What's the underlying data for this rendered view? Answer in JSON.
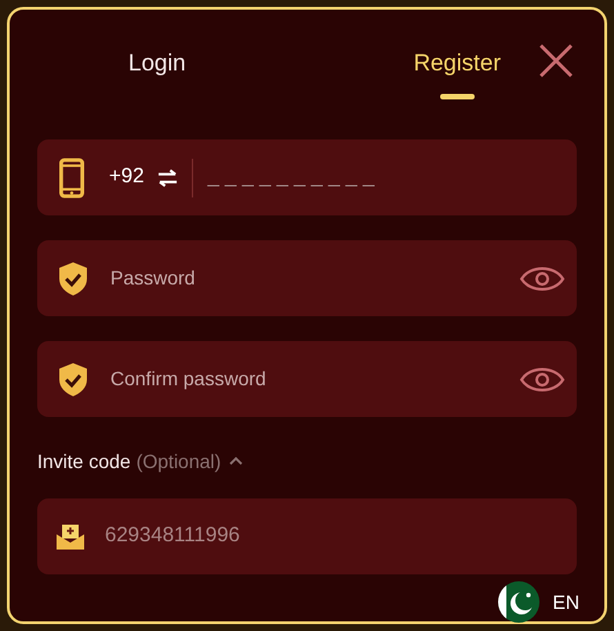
{
  "tabs": [
    {
      "label": "Login",
      "selected": false
    },
    {
      "label": "Register",
      "selected": true
    }
  ],
  "phone": {
    "country_code": "+92",
    "placeholder": "_ _ _ _ _ _ _ _ _ _"
  },
  "password_fields": [
    {
      "placeholder": "Password"
    },
    {
      "placeholder": "Confirm password"
    }
  ],
  "invite": {
    "label": "Invite code",
    "hint": "(Optional)",
    "expanded": true,
    "value": "629348111996"
  },
  "language": "EN"
}
